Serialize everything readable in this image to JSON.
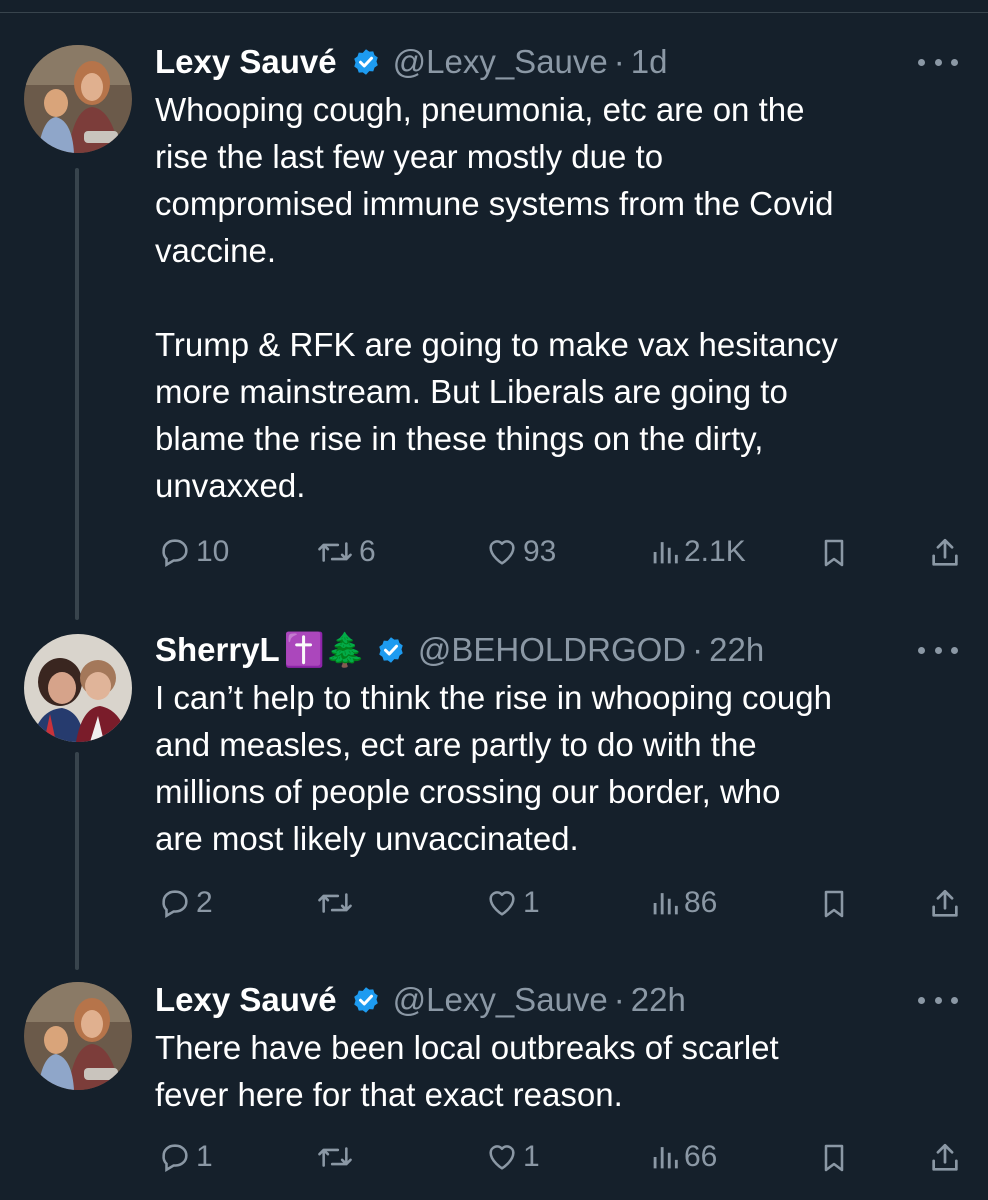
{
  "tweets": [
    {
      "name": "Lexy Sauvé",
      "emoji": "",
      "handle": "@Lexy_Sauve",
      "time": "1d",
      "text": "Whooping cough, pneumonia, etc are on the\nrise the last few year mostly due to\ncompromised immune systems from the Covid\nvaccine.\n\nTrump & RFK are going to make vax hesitancy\nmore mainstream. But Liberals are going to\nblame the rise in these things on the dirty,\nunvaxxed.",
      "replies": "10",
      "reposts": "6",
      "likes": "93",
      "views": "2.1K"
    },
    {
      "name": "SherryL",
      "emoji": "✝️🌲",
      "handle": "@BEHOLDRGOD",
      "time": "22h",
      "text": "I can’t help to think the rise in whooping cough\nand measles, ect are partly to do with the\nmillions of people crossing our border, who\nare most likely unvaccinated.",
      "replies": "2",
      "reposts": "",
      "likes": "1",
      "views": "86"
    },
    {
      "name": "Lexy Sauvé",
      "emoji": "",
      "handle": "@Lexy_Sauve",
      "time": "22h",
      "text": "There have been local outbreaks of scarlet\nfever here for that exact reason.",
      "replies": "1",
      "reposts": "",
      "likes": "1",
      "views": "66"
    }
  ],
  "separator": "·",
  "colors": {
    "background": "#15202b",
    "text": "#ffffff",
    "muted": "#8b98a5",
    "verified": "#1d9bf0",
    "thread_line": "#38444d"
  },
  "icons": [
    "verified-badge-icon",
    "more-icon",
    "reply-icon",
    "repost-icon",
    "like-icon",
    "views-icon",
    "bookmark-icon",
    "share-icon"
  ]
}
